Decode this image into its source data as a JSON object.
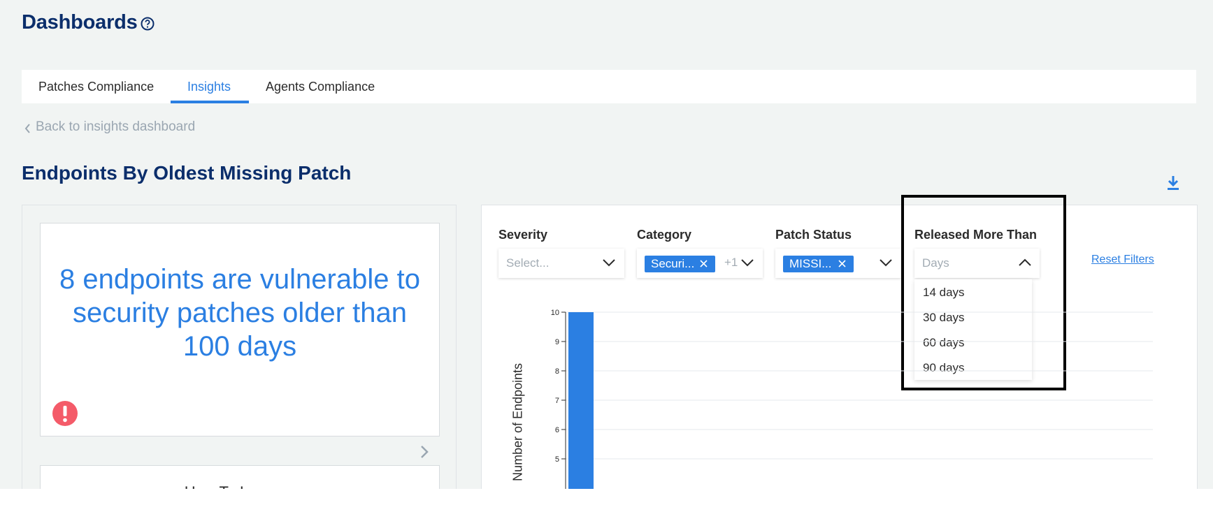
{
  "header": {
    "title": "Dashboards",
    "help_icon": "help-circle-icon"
  },
  "tabs": [
    {
      "label": "Patches Compliance",
      "active": false
    },
    {
      "label": "Insights",
      "active": true
    },
    {
      "label": "Agents Compliance",
      "active": false
    }
  ],
  "back_link": "Back to insights dashboard",
  "section_title": "Endpoints By Oldest Missing Patch",
  "download_icon": "download-icon",
  "insight_card": {
    "message": "8 endpoints are vulnerable to security patches older than 100 days",
    "icon": "alert-icon",
    "icon_color": "#f45b69"
  },
  "improve_card": {
    "title": "How To Improve"
  },
  "filters": {
    "severity": {
      "label": "Severity",
      "placeholder": "Select..."
    },
    "category": {
      "label": "Category",
      "chip": "Securi...",
      "extra_count": "+1"
    },
    "patch_status": {
      "label": "Patch Status",
      "chip": "MISSI..."
    },
    "released": {
      "label": "Released More Than",
      "placeholder": "Days",
      "options": [
        "14 days",
        "30 days",
        "60 days",
        "90 days"
      ]
    },
    "reset_label": "Reset Filters"
  },
  "colors": {
    "accent": "#2b7fe2",
    "title": "#0b2e6b"
  },
  "chart_data": {
    "type": "bar",
    "ylabel": "Number of Endpoints",
    "ticks": [
      "10",
      "9",
      "8",
      "7",
      "6",
      "5"
    ],
    "ylim": [
      4,
      10
    ],
    "values": [
      10
    ]
  }
}
